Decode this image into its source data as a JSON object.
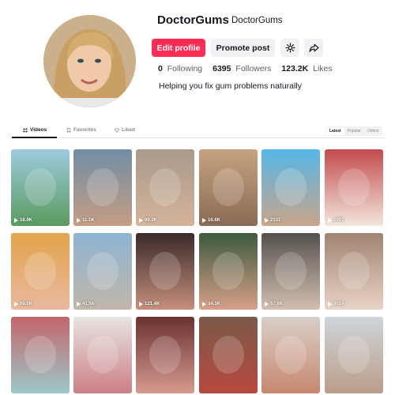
{
  "profile": {
    "username": "DoctorGums",
    "nickname": "DoctorGums",
    "bio": "Helping you fix gum problems naturally",
    "edit_label": "Edit profile",
    "promote_label": "Promote post"
  },
  "stats": [
    {
      "value": "0",
      "label": "Following"
    },
    {
      "value": "6395",
      "label": "Followers"
    },
    {
      "value": "123.2K",
      "label": "Likes"
    }
  ],
  "tabs": [
    {
      "label": "Videos",
      "icon": "grid-icon"
    },
    {
      "label": "Favorites",
      "icon": "bookmark-icon"
    },
    {
      "label": "Liked",
      "icon": "heart-icon"
    }
  ],
  "sort": [
    "Latest",
    "Popular",
    "Oldest"
  ],
  "colors": {
    "accent": "#fe2c55",
    "text": "#161823",
    "muted": "#8a8b91"
  },
  "videos": [
    {
      "views": "18.9K"
    },
    {
      "views": "11.1K"
    },
    {
      "views": "99.2K"
    },
    {
      "views": "16.6K"
    },
    {
      "views": "2131"
    },
    {
      "views": "2007"
    },
    {
      "views": "69.6K"
    },
    {
      "views": "41.5K"
    },
    {
      "views": "121.4K"
    },
    {
      "views": "34.3K"
    },
    {
      "views": "57.6K"
    },
    {
      "views": "3024"
    },
    {
      "views": ""
    },
    {
      "views": ""
    },
    {
      "views": ""
    },
    {
      "views": ""
    },
    {
      "views": ""
    },
    {
      "views": ""
    }
  ]
}
